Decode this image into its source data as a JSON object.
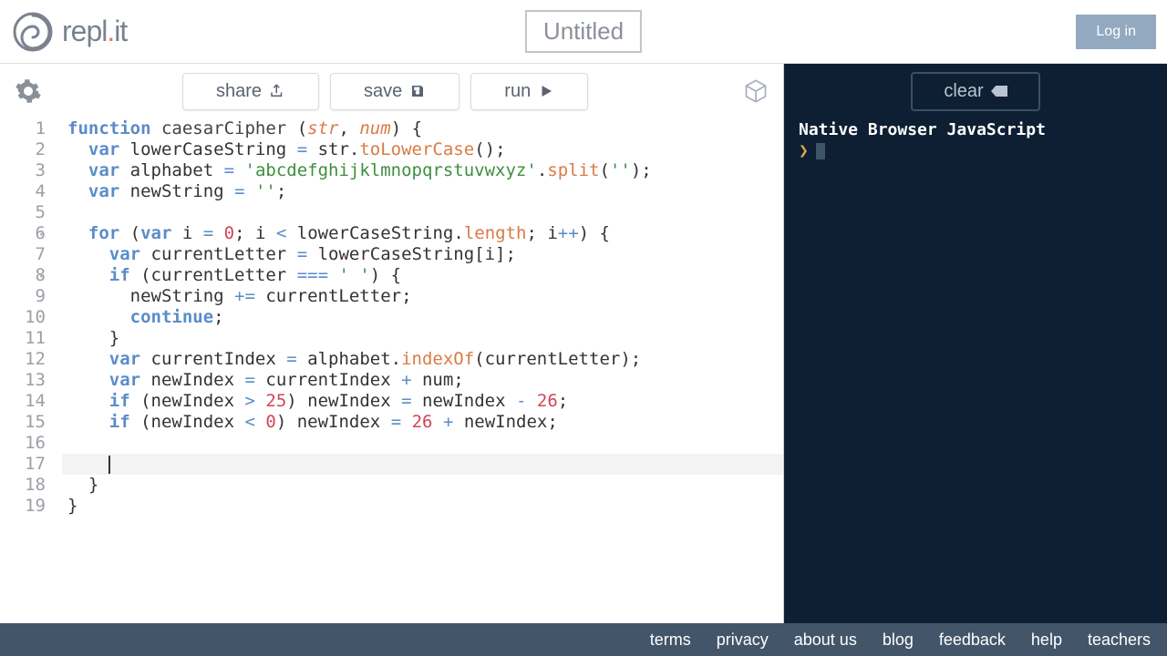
{
  "header": {
    "site_name_pre": "repl",
    "site_name_post": "it",
    "title": "Untitled",
    "login": "Log in"
  },
  "toolbar": {
    "share": "share",
    "save": "save",
    "run": "run"
  },
  "console": {
    "clear": "clear",
    "engine": "Native Browser JavaScript"
  },
  "editor": {
    "active_line": 17,
    "lines": [
      {
        "n": 1,
        "fold": true,
        "tokens": [
          [
            "kw",
            "function"
          ],
          [
            "",
            " "
          ],
          [
            "fn",
            "caesarCipher"
          ],
          [
            "",
            " ("
          ],
          [
            "param",
            "str"
          ],
          [
            "",
            ", "
          ],
          [
            "param",
            "num"
          ],
          [
            "",
            ") {"
          ]
        ]
      },
      {
        "n": 2,
        "tokens": [
          [
            "",
            "  "
          ],
          [
            "kw",
            "var"
          ],
          [
            "",
            " lowerCaseString "
          ],
          [
            "op",
            "="
          ],
          [
            "",
            " str."
          ],
          [
            "method",
            "toLowerCase"
          ],
          [
            "",
            "();"
          ]
        ]
      },
      {
        "n": 3,
        "tokens": [
          [
            "",
            "  "
          ],
          [
            "kw",
            "var"
          ],
          [
            "",
            " alphabet "
          ],
          [
            "op",
            "="
          ],
          [
            "",
            " "
          ],
          [
            "str",
            "'abcdefghijklmnopqrstuvwxyz'"
          ],
          [
            "",
            "."
          ],
          [
            "method",
            "split"
          ],
          [
            "",
            "("
          ],
          [
            "str",
            "''"
          ],
          [
            "",
            ");"
          ]
        ]
      },
      {
        "n": 4,
        "tokens": [
          [
            "",
            "  "
          ],
          [
            "kw",
            "var"
          ],
          [
            "",
            " newString "
          ],
          [
            "op",
            "="
          ],
          [
            "",
            " "
          ],
          [
            "str",
            "''"
          ],
          [
            "",
            ";"
          ]
        ]
      },
      {
        "n": 5,
        "tokens": [
          [
            "",
            "  "
          ]
        ]
      },
      {
        "n": 6,
        "fold": true,
        "tokens": [
          [
            "",
            "  "
          ],
          [
            "kw",
            "for"
          ],
          [
            "",
            " ("
          ],
          [
            "kw",
            "var"
          ],
          [
            "",
            " i "
          ],
          [
            "op",
            "="
          ],
          [
            "",
            " "
          ],
          [
            "num",
            "0"
          ],
          [
            "",
            "; i "
          ],
          [
            "op",
            "<"
          ],
          [
            "",
            " lowerCaseString."
          ],
          [
            "method",
            "length"
          ],
          [
            "",
            "; i"
          ],
          [
            "op",
            "++"
          ],
          [
            "",
            ") {"
          ]
        ]
      },
      {
        "n": 7,
        "tokens": [
          [
            "",
            "    "
          ],
          [
            "kw",
            "var"
          ],
          [
            "",
            " currentLetter "
          ],
          [
            "op",
            "="
          ],
          [
            "",
            " lowerCaseString[i];"
          ]
        ]
      },
      {
        "n": 8,
        "fold": true,
        "tokens": [
          [
            "",
            "    "
          ],
          [
            "kw",
            "if"
          ],
          [
            "",
            " (currentLetter "
          ],
          [
            "op",
            "==="
          ],
          [
            "",
            " "
          ],
          [
            "str",
            "' '"
          ],
          [
            "",
            ") {"
          ]
        ]
      },
      {
        "n": 9,
        "tokens": [
          [
            "",
            "      newString "
          ],
          [
            "op",
            "+="
          ],
          [
            "",
            " currentLetter;"
          ]
        ]
      },
      {
        "n": 10,
        "tokens": [
          [
            "",
            "      "
          ],
          [
            "kw",
            "continue"
          ],
          [
            "",
            ";"
          ]
        ]
      },
      {
        "n": 11,
        "tokens": [
          [
            "",
            "    }"
          ]
        ]
      },
      {
        "n": 12,
        "tokens": [
          [
            "",
            "    "
          ],
          [
            "kw",
            "var"
          ],
          [
            "",
            " currentIndex "
          ],
          [
            "op",
            "="
          ],
          [
            "",
            " alphabet."
          ],
          [
            "method",
            "indexOf"
          ],
          [
            "",
            "(currentLetter);"
          ]
        ]
      },
      {
        "n": 13,
        "tokens": [
          [
            "",
            "    "
          ],
          [
            "kw",
            "var"
          ],
          [
            "",
            " newIndex "
          ],
          [
            "op",
            "="
          ],
          [
            "",
            " currentIndex "
          ],
          [
            "op",
            "+"
          ],
          [
            "",
            " num;"
          ]
        ]
      },
      {
        "n": 14,
        "tokens": [
          [
            "",
            "    "
          ],
          [
            "kw",
            "if"
          ],
          [
            "",
            " (newIndex "
          ],
          [
            "op",
            ">"
          ],
          [
            "",
            " "
          ],
          [
            "num",
            "25"
          ],
          [
            "",
            ") newIndex "
          ],
          [
            "op",
            "="
          ],
          [
            "",
            " newIndex "
          ],
          [
            "op",
            "-"
          ],
          [
            "",
            " "
          ],
          [
            "num",
            "26"
          ],
          [
            "",
            ";"
          ]
        ]
      },
      {
        "n": 15,
        "tokens": [
          [
            "",
            "    "
          ],
          [
            "kw",
            "if"
          ],
          [
            "",
            " (newIndex "
          ],
          [
            "op",
            "<"
          ],
          [
            "",
            " "
          ],
          [
            "num",
            "0"
          ],
          [
            "",
            ") newIndex "
          ],
          [
            "op",
            "="
          ],
          [
            "",
            " "
          ],
          [
            "num",
            "26"
          ],
          [
            "",
            " "
          ],
          [
            "op",
            "+"
          ],
          [
            "",
            " newIndex;"
          ]
        ]
      },
      {
        "n": 16,
        "tokens": [
          [
            "",
            "    "
          ]
        ]
      },
      {
        "n": 17,
        "tokens": [
          [
            "",
            "    "
          ]
        ],
        "cursor": true
      },
      {
        "n": 18,
        "tokens": [
          [
            "",
            "  }"
          ]
        ]
      },
      {
        "n": 19,
        "tokens": [
          [
            "",
            "}"
          ]
        ]
      }
    ]
  },
  "footer": {
    "links": [
      "terms",
      "privacy",
      "about us",
      "blog",
      "feedback",
      "help",
      "teachers"
    ]
  }
}
